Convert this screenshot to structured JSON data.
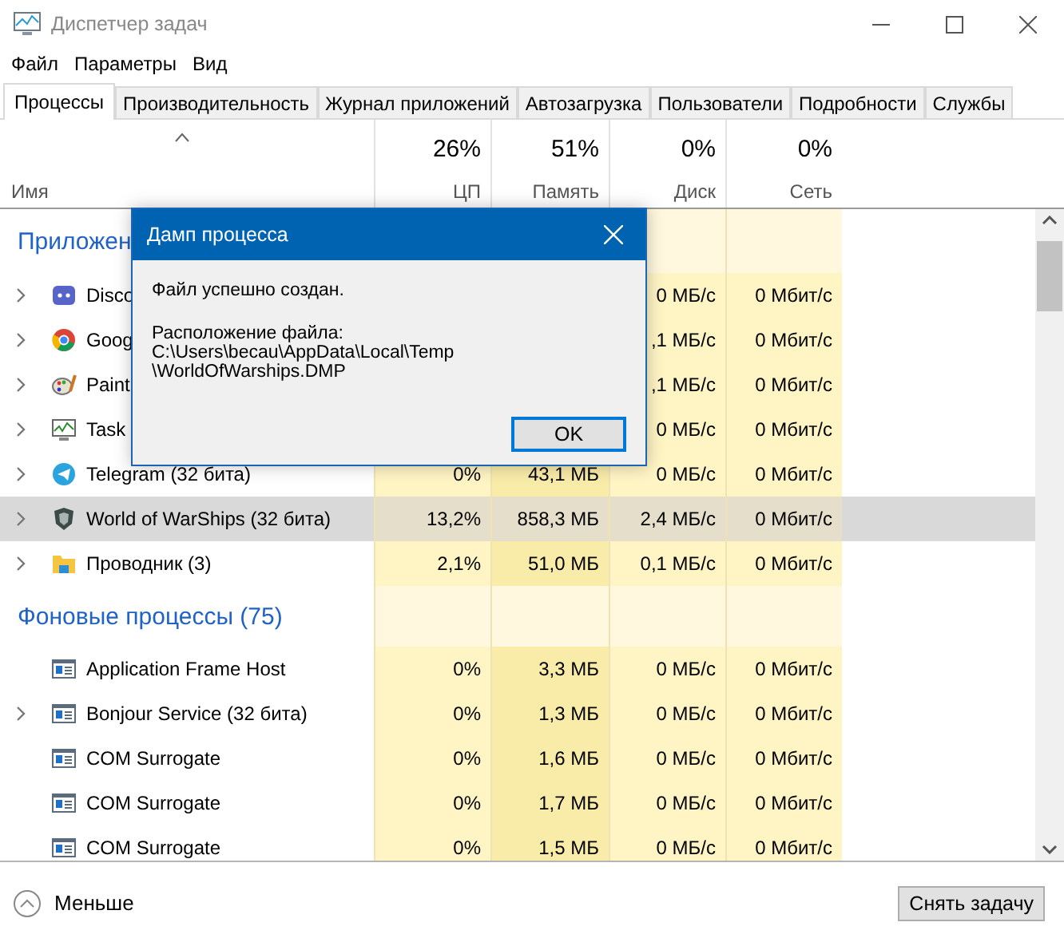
{
  "window": {
    "title": "Диспетчер задач"
  },
  "menu": [
    "Файл",
    "Параметры",
    "Вид"
  ],
  "tabs": [
    {
      "label": "Процессы",
      "selected": true
    },
    {
      "label": "Производительность",
      "selected": false
    },
    {
      "label": "Журнал приложений",
      "selected": false
    },
    {
      "label": "Автозагрузка",
      "selected": false
    },
    {
      "label": "Пользователи",
      "selected": false
    },
    {
      "label": "Подробности",
      "selected": false
    },
    {
      "label": "Службы",
      "selected": false
    }
  ],
  "columns": [
    {
      "label": "Имя"
    },
    {
      "total": "26%",
      "label": "ЦП"
    },
    {
      "total": "51%",
      "label": "Память"
    },
    {
      "total": "0%",
      "label": "Диск"
    },
    {
      "total": "0%",
      "label": "Сеть"
    }
  ],
  "groups": [
    {
      "title": "Приложен",
      "rows": [
        {
          "name": "Disco",
          "expandable": true,
          "selected": false,
          "disk": "0 МБ/с",
          "net": "0 Мбит/с"
        },
        {
          "name": "Goog",
          "expandable": true,
          "selected": false,
          "disk": ",1 МБ/с",
          "net": "0 Мбит/с"
        },
        {
          "name": "Paint",
          "expandable": true,
          "selected": false,
          "disk": ",1 МБ/с",
          "net": "0 Мбит/с"
        },
        {
          "name": "Task",
          "expandable": true,
          "selected": false,
          "disk": "0 МБ/с",
          "net": "0 Мбит/с"
        },
        {
          "name": "Telegram (32 бита)",
          "expandable": true,
          "selected": false,
          "cpu": "0%",
          "mem": "43,1 МБ",
          "disk": "0 МБ/с",
          "net": "0 Мбит/с"
        },
        {
          "name": "World of WarShips (32 бита)",
          "expandable": true,
          "selected": true,
          "cpu": "13,2%",
          "mem": "858,3 МБ",
          "disk": "2,4 МБ/с",
          "net": "0 Мбит/с"
        },
        {
          "name": "Проводник (3)",
          "expandable": true,
          "selected": false,
          "cpu": "2,1%",
          "mem": "51,0 МБ",
          "disk": "0,1 МБ/с",
          "net": "0 Мбит/с"
        }
      ]
    },
    {
      "title": "Фоновые процессы (75)",
      "rows": [
        {
          "name": "Application Frame Host",
          "expandable": false,
          "selected": false,
          "cpu": "0%",
          "mem": "3,3 МБ",
          "disk": "0 МБ/с",
          "net": "0 Мбит/с"
        },
        {
          "name": "Bonjour Service (32 бита)",
          "expandable": true,
          "selected": false,
          "cpu": "0%",
          "mem": "1,3 МБ",
          "disk": "0 МБ/с",
          "net": "0 Мбит/с"
        },
        {
          "name": "COM Surrogate",
          "expandable": false,
          "selected": false,
          "cpu": "0%",
          "mem": "1,6 МБ",
          "disk": "0 МБ/с",
          "net": "0 Мбит/с"
        },
        {
          "name": "COM Surrogate",
          "expandable": false,
          "selected": false,
          "cpu": "0%",
          "mem": "1,7 МБ",
          "disk": "0 МБ/с",
          "net": "0 Мбит/с"
        },
        {
          "name": "COM Surrogate",
          "expandable": false,
          "selected": false,
          "cpu": "0%",
          "mem": "1,5 МБ",
          "disk": "0 МБ/с",
          "net": "0 Мбит/с"
        }
      ]
    }
  ],
  "dialog": {
    "title": "Дамп процесса",
    "message": "Файл успешно создан.",
    "location_label": "Расположение файла:",
    "path_lines": [
      "C:\\Users\\becau\\AppData\\Local\\Temp",
      "\\WorldOfWarships.DMP"
    ],
    "button": "OK"
  },
  "footer": {
    "less": "Меньше",
    "end_task": "Снять задачу"
  }
}
